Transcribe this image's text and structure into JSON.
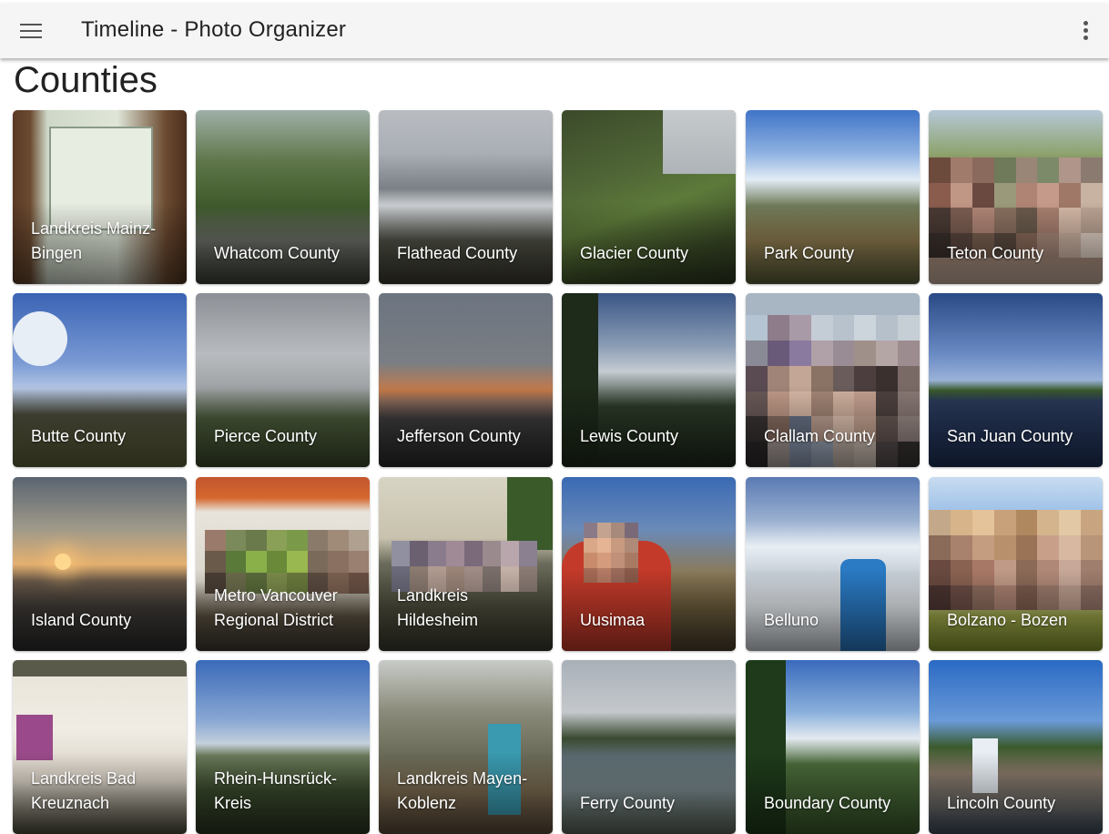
{
  "app": {
    "title": "Timeline - Photo Organizer"
  },
  "page": {
    "heading": "Counties"
  },
  "icons": {
    "menu": "hamburger-menu-icon",
    "more": "more-vertical-icon"
  },
  "tiles": [
    {
      "label": "Landkreis Mainz-Bingen"
    },
    {
      "label": "Whatcom County"
    },
    {
      "label": "Flathead County"
    },
    {
      "label": "Glacier County"
    },
    {
      "label": "Park County"
    },
    {
      "label": "Teton County"
    },
    {
      "label": "Butte County"
    },
    {
      "label": "Pierce County"
    },
    {
      "label": "Jefferson County"
    },
    {
      "label": "Lewis County"
    },
    {
      "label": "Clallam County"
    },
    {
      "label": "San Juan County"
    },
    {
      "label": "Island County"
    },
    {
      "label": "Metro Vancouver Regional District"
    },
    {
      "label": "Landkreis Hildesheim"
    },
    {
      "label": "Uusimaa"
    },
    {
      "label": "Belluno"
    },
    {
      "label": "Bolzano - Bozen"
    },
    {
      "label": "Landkreis Bad Kreuznach"
    },
    {
      "label": "Rhein-Hunsrück-Kreis"
    },
    {
      "label": "Landkreis Mayen-Koblenz"
    },
    {
      "label": "Ferry County"
    },
    {
      "label": "Boundary County"
    },
    {
      "label": "Lincoln County"
    }
  ]
}
